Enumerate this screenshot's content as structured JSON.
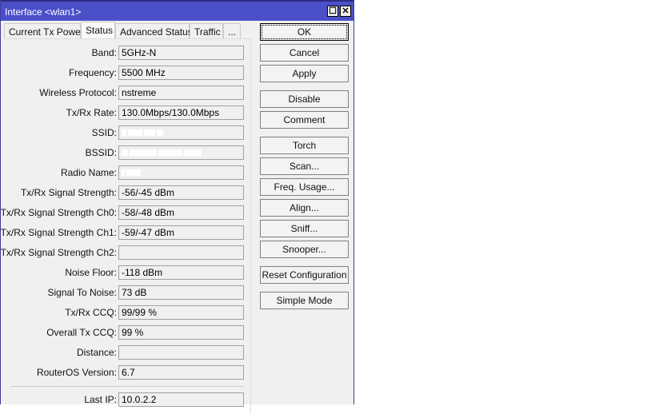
{
  "window": {
    "title": "Interface <wlan1>",
    "maximize_icon": "☐",
    "close_icon": "✕"
  },
  "tabs": [
    "Current Tx Power",
    "Status",
    "Advanced Status",
    "Traffic",
    "..."
  ],
  "active_tab": "Status",
  "fields": [
    {
      "label": "Band:",
      "value": "5GHz-N"
    },
    {
      "label": "Frequency:",
      "value": "5500 MHz"
    },
    {
      "label": "Wireless Protocol:",
      "value": "nstreme"
    },
    {
      "label": "Tx/Rx Rate:",
      "value": "130.0Mbps/130.0Mbps"
    },
    {
      "label": "SSID:",
      "value": ""
    },
    {
      "label": "BSSID:",
      "value": ""
    },
    {
      "label": "Radio Name:",
      "value": ""
    },
    {
      "label": "Tx/Rx Signal Strength:",
      "value": "-56/-45 dBm"
    },
    {
      "label": "Tx/Rx Signal Strength Ch0:",
      "value": "-58/-48 dBm"
    },
    {
      "label": "Tx/Rx Signal Strength Ch1:",
      "value": "-59/-47 dBm"
    },
    {
      "label": "Tx/Rx Signal Strength Ch2:",
      "value": ""
    },
    {
      "label": "Noise Floor:",
      "value": "-118 dBm"
    },
    {
      "label": "Signal To Noise:",
      "value": "73 dB"
    },
    {
      "label": "Tx/Rx CCQ:",
      "value": "99/99 %"
    },
    {
      "label": "Overall Tx CCQ:",
      "value": "99 %"
    },
    {
      "label": "Distance:",
      "value": ""
    },
    {
      "label": "RouterOS Version:",
      "value": "6.7"
    }
  ],
  "last_ip": {
    "label": "Last IP:",
    "value": "10.0.2.2"
  },
  "buttons": [
    "OK",
    "Cancel",
    "Apply",
    "Disable",
    "Comment",
    "Torch",
    "Scan...",
    "Freq. Usage...",
    "Align...",
    "Sniff...",
    "Snooper...",
    "Reset Configuration",
    "Simple Mode"
  ]
}
